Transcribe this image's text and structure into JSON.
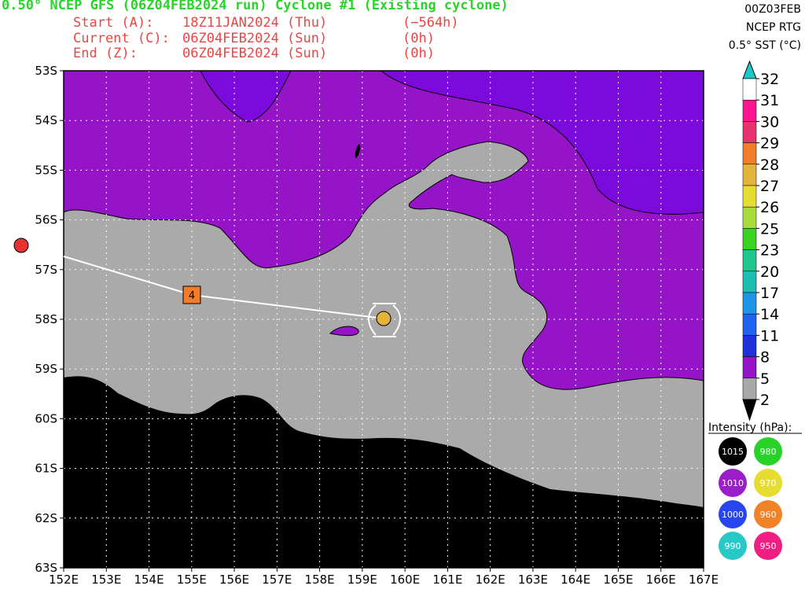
{
  "header": {
    "title": "0.50° NCEP GFS (06Z04FEB2024 run) Cyclone #1 (Existing cyclone)",
    "start_label": "Start (A):",
    "start_date": "18Z11JAN2024 (Thu)",
    "start_offset": "(−564h)",
    "current_label": "Current (C):",
    "current_date": "06Z04FEB2024 (Sun)",
    "current_offset": "(0h)",
    "end_label": "End (Z):",
    "end_date": "06Z04FEB2024 (Sun)",
    "end_offset": "(0h)"
  },
  "corner": {
    "date": "00Z03FEB",
    "source": "NCEP RTG",
    "field": "0.5° SST (°C)"
  },
  "lat_ticks": [
    "53S",
    "54S",
    "55S",
    "56S",
    "57S",
    "58S",
    "59S",
    "60S",
    "61S",
    "62S",
    "63S"
  ],
  "lon_ticks": [
    "152E",
    "153E",
    "154E",
    "155E",
    "156E",
    "157E",
    "158E",
    "159E",
    "160E",
    "161E",
    "162E",
    "163E",
    "164E",
    "165E",
    "166E",
    "167E"
  ],
  "colorbar": {
    "labels": [
      "32",
      "31",
      "30",
      "29",
      "28",
      "27",
      "26",
      "25",
      "23",
      "20",
      "17",
      "14",
      "11",
      "8",
      "5",
      "2"
    ],
    "colors": [
      "#ffffff",
      "#ff1493",
      "#e8336f",
      "#f07d2b",
      "#e6b33a",
      "#e6dc32",
      "#a8dc3c",
      "#3cd21e",
      "#1ec88c",
      "#1ebeb4",
      "#1e96e6",
      "#1e64f0",
      "#1e32dc",
      "#9614c8",
      "#a9a9a9"
    ],
    "top_arrow_color": "#1ec8c8",
    "bottom_arrow_color": "#000000"
  },
  "intensity": {
    "title": "Intensity (hPa):",
    "items": [
      {
        "label": "1015",
        "color": "#000000"
      },
      {
        "label": "980",
        "color": "#28d228"
      },
      {
        "label": "1010",
        "color": "#9b1fc8"
      },
      {
        "label": "970",
        "color": "#e6dc32"
      },
      {
        "label": "1000",
        "color": "#2846f0"
      },
      {
        "label": "960",
        "color": "#f08228"
      },
      {
        "label": "990",
        "color": "#28c8c8"
      },
      {
        "label": "950",
        "color": "#f01e82"
      }
    ]
  },
  "track": {
    "marker_label": "4",
    "marker_color": "#f07d2b",
    "current_color": "#e6b33a",
    "start_dot_color": "#e83232"
  },
  "colors": {
    "land": "#000000",
    "sst_2_5": "#aaaaaa",
    "sst_5_8": "#9614c8",
    "sst_8_11": "#7d0adc",
    "title_green": "#2bd42b",
    "subtitle_red": "#ee4444"
  }
}
